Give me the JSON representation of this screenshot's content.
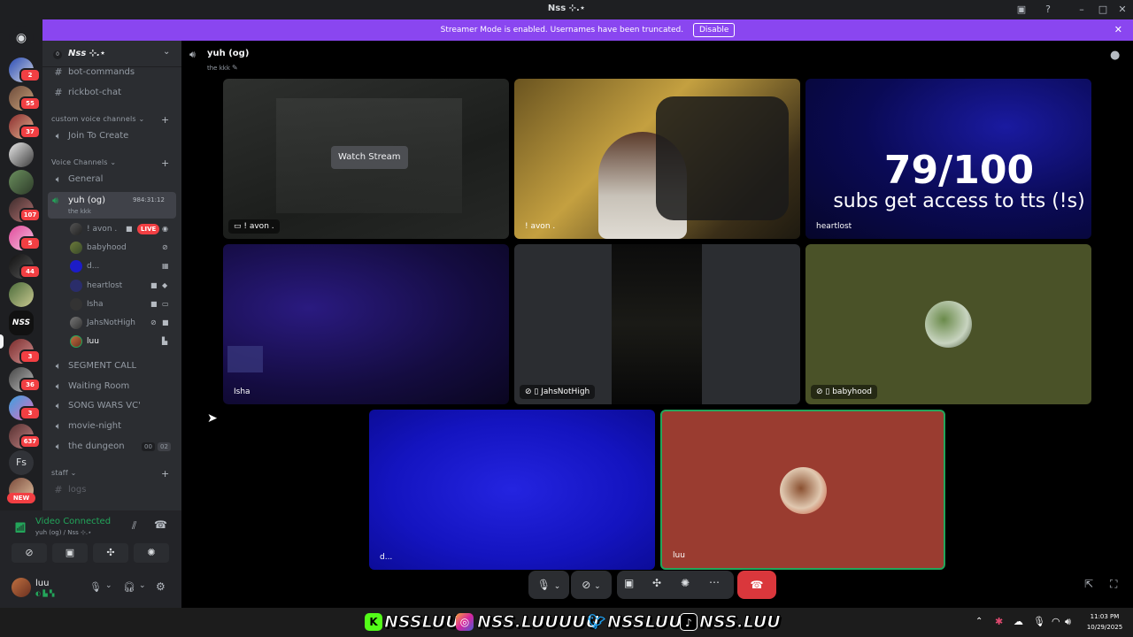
{
  "window": {
    "title": "Nss ⊹.⋆"
  },
  "banner": {
    "text": "Streamer Mode is enabled. Usernames have been truncated.",
    "button": "Disable"
  },
  "guild_badges": [
    "2",
    "55",
    "37",
    "107",
    "5",
    "44",
    "3",
    "36",
    "3",
    "637"
  ],
  "guild_fs": "Fs",
  "guild_new": "NEW",
  "server": {
    "name": "Nss ⊹.⋆"
  },
  "channels": {
    "bot_commands": "bot-commands",
    "rickbot_chat": "rickbot-chat",
    "custom_voice_cat": "custom voice channels",
    "join_to_create": "Join To Create",
    "voice_cat": "Voice Channels",
    "general": "General",
    "current": "yuh (og)",
    "current_sub": "the kkk",
    "current_timer": "984:31:12",
    "segment_call": "SEGMENT CALL",
    "waiting_room": "Waiting Room",
    "song_wars": "SONG WARS VC'",
    "movie_night": "movie-night",
    "dungeon": "the dungeon",
    "dungeon_counts": [
      "00",
      "02"
    ],
    "staff_cat": "staff",
    "logs": "logs"
  },
  "voice_users": [
    {
      "name": "! avon .",
      "live": "LIVE"
    },
    {
      "name": "babyhood"
    },
    {
      "name": "d..."
    },
    {
      "name": "heartlost"
    },
    {
      "name": "Isha"
    },
    {
      "name": "JahsNotHigh"
    },
    {
      "name": "luu"
    }
  ],
  "voice_status": {
    "title": "Video Connected",
    "sub": "yuh (og) / Nss ⊹.⋆"
  },
  "user": {
    "name": "luu"
  },
  "header": {
    "channel": "yuh (og)",
    "topic": "the kkk"
  },
  "tiles": {
    "watch_stream": "Watch Stream",
    "stream_label": "! avon .",
    "avon_label": "! avon .",
    "heartlost_label": "heartlost",
    "overlay_big": "79/100",
    "overlay_small": "subs get access to tts (!s)",
    "isha_label": "Isha",
    "jahs_label": "JahsNotHigh",
    "babyhood_label": "babyhood",
    "d_label": "d...",
    "luu_label": "luu"
  },
  "socials": [
    "NSSLUU",
    "NSS.LUUUUU",
    "NSSLUU",
    "NSS.LUU"
  ],
  "clock": {
    "time": "11:03 PM",
    "date": "10/29/2025"
  },
  "colors": {
    "accent": "#5865f2",
    "banner": "#8a46f0",
    "live": "#f23f43",
    "connected": "#23a55a",
    "hangup": "#da373c"
  }
}
